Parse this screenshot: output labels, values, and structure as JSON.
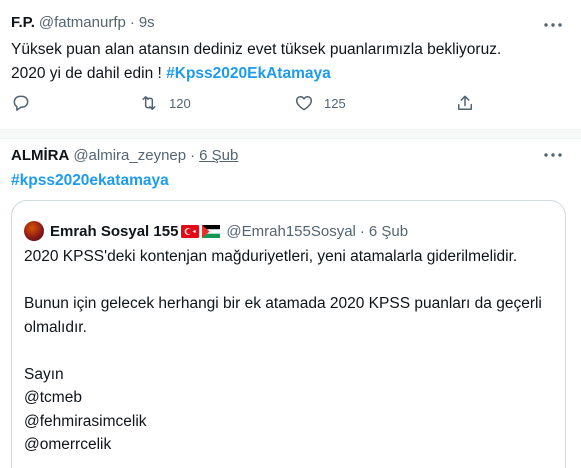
{
  "tweet1": {
    "name": "F.P.",
    "handle": "@fatmanurfp",
    "separator": "·",
    "time": "9s",
    "text_line1": "Yüksek puan alan atansın dediniz evet tüksek puanlarımızla bekliyoruz.",
    "text_line2": "2020 yi de dahil edin ! ",
    "hashtag": "#Kpss2020EkAtamaya",
    "actions": {
      "reply_icon": "reply-icon",
      "retweet_icon": "retweet-icon",
      "retweet_count": "120",
      "like_icon": "heart-icon",
      "like_count": "125",
      "share_icon": "share-icon"
    }
  },
  "tweet2": {
    "name": "ALMİRA",
    "handle": "@almira_zeynep",
    "separator": "·",
    "time": "6 Şub",
    "hashtag": "#kpss2020ekatamaya",
    "quote": {
      "name": "Emrah Sosyal 155",
      "handle": "@Emrah155Sosyal",
      "separator": "·",
      "time": "6 Şub",
      "text": "2020 KPSS'deki kontenjan mağduriyetleri, yeni atamalarla giderilmelidir.\n\nBunun için gelecek herhangi bir ek atamada 2020 KPSS puanları da geçerli olmalıdır.\n\nSayın\n@tcmeb\n@fehmirasimcelik\n@omerrcelik"
    }
  },
  "colors": {
    "accent": "#1d9bf0",
    "secondary_text": "#536471",
    "primary_text": "#0f1419",
    "border": "#cfd9de"
  }
}
